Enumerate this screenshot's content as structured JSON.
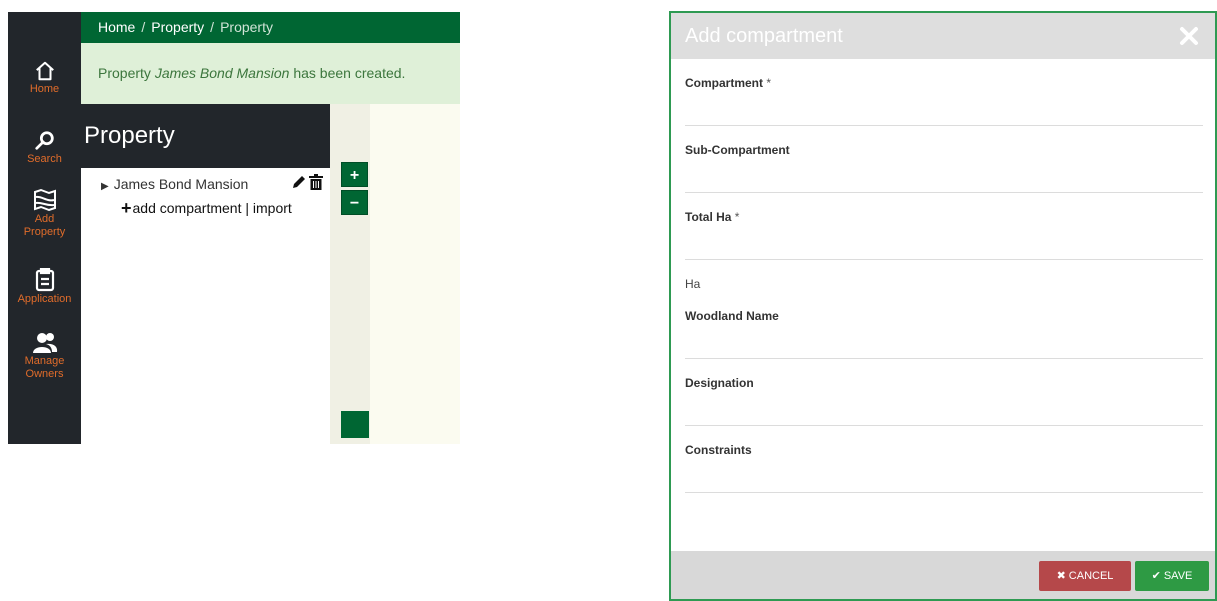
{
  "sidebar": {
    "items": [
      {
        "label": "Home",
        "icon": "home-icon"
      },
      {
        "label": "Search",
        "icon": "search-icon"
      },
      {
        "label": "Add Property",
        "icon": "map-icon"
      },
      {
        "label": "Application",
        "icon": "clipboard-icon"
      },
      {
        "label": "Manage Owners",
        "icon": "users-icon"
      }
    ]
  },
  "breadcrumb": {
    "home": "Home",
    "property": "Property",
    "current": "Property",
    "separator": "/"
  },
  "alert": {
    "prefix": "Property ",
    "name": "James Bond Mansion",
    "suffix": " has been created."
  },
  "property_panel": {
    "title": "Property",
    "tree_item": "James Bond Mansion",
    "add_compartment": "add compartment",
    "divider": "|",
    "import": "import"
  },
  "map": {
    "zoom_in": "+",
    "zoom_out": "−"
  },
  "modal": {
    "title": "Add compartment",
    "fields": [
      {
        "label": "Compartment",
        "required": true
      },
      {
        "label": "Sub-Compartment",
        "required": false
      },
      {
        "label": "Total Ha",
        "required": true
      },
      {
        "label": "Woodland Name",
        "required": false
      },
      {
        "label": "Designation",
        "required": false
      },
      {
        "label": "Constraints",
        "required": false
      }
    ],
    "required_mark": "*",
    "ha_unit": "Ha",
    "cancel_label": "CANCEL",
    "save_label": "SAVE"
  },
  "colors": {
    "brand_green": "#006633",
    "sidebar_dark": "#22262b",
    "sidebar_label": "#e06c2b",
    "cancel_red": "#b5484a",
    "save_green": "#2e9a44",
    "alert_bg": "#dff0d8"
  }
}
